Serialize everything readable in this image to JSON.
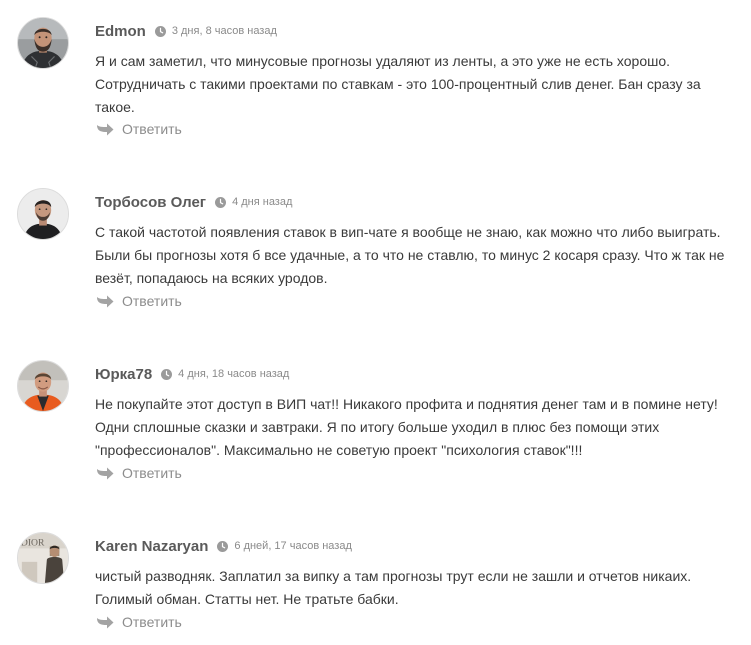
{
  "reply_label": "Ответить",
  "accent_colors": {
    "author": "#5a5a5a",
    "muted": "#8a8a8a",
    "text": "#3a3a3a"
  },
  "comments": [
    {
      "author": "Edmon",
      "time": "3 дня, 8 часов назад",
      "avatar_icon": "bearded-man-avatar",
      "lines": [
        "Я и сам заметил, что минусовые прогнозы удаляют из ленты, а это уже не есть хорошо.",
        "Сотрудничать с такими проектами по ставкам - это 100-процентный слив денег. Бан сразу за",
        "такое."
      ]
    },
    {
      "author": "Торбосов Олег",
      "time": "4 дня назад",
      "avatar_icon": "man-portrait-avatar",
      "lines": [
        "С такой частотой появления ставок в вип-чате я вообще не знаю, как можно что либо выиграть.",
        "Были бы прогнозы хотя б все удачные, а то что не ставлю, то минус 2 косаря сразу. Что ж так не",
        "везёт, попадаюсь на всяких уродов."
      ]
    },
    {
      "author": "Юрка78",
      "time": "4 дня, 18 часов назад",
      "avatar_icon": "man-orange-jacket-avatar",
      "lines": [
        "Не покупайте этот доступ в ВИП чат!! Никакого профита и поднятия денег там и в помине нету!",
        "Одни сплошные сказки и завтраки. Я по итогу больше уходил в плюс без помощи этих",
        "\"профессионалов\". Максимально не советую проект \"психология ставок\"!!!"
      ]
    },
    {
      "author": "Karen Nazaryan",
      "time": "6 дней, 17 часов назад",
      "avatar_icon": "man-in-store-avatar",
      "avatar_sign": "DIOR",
      "lines": [
        "чистый разводняк. Заплатил за випку а там прогнозы трут если не зашли и отчетов никаих.",
        "Голимый обман. Статты нет. Не тратьте бабки."
      ]
    }
  ]
}
